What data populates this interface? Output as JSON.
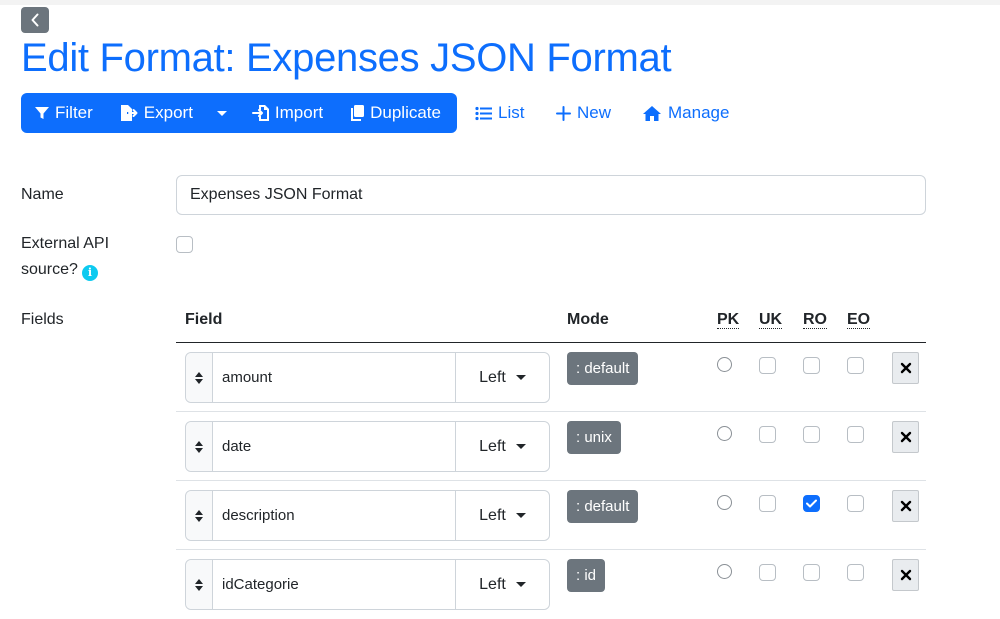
{
  "page": {
    "title": "Edit Format: Expenses JSON Format"
  },
  "toolbar": {
    "filter": "Filter",
    "export": "Export",
    "import": "Import",
    "duplicate": "Duplicate",
    "list": "List",
    "new": "New",
    "manage": "Manage"
  },
  "form": {
    "name_label": "Name",
    "name_value": "Expenses JSON Format",
    "api_label": "External API source?",
    "api_checked": false,
    "fields_label": "Fields"
  },
  "table": {
    "headers": {
      "field": "Field",
      "mode": "Mode",
      "pk": "PK",
      "uk": "UK",
      "ro": "RO",
      "eo": "EO"
    },
    "rows": [
      {
        "field": "amount",
        "align": "Left",
        "mode": ": default",
        "pk": false,
        "uk": false,
        "ro": false,
        "eo": false
      },
      {
        "field": "date",
        "align": "Left",
        "mode": ": unix",
        "pk": false,
        "uk": false,
        "ro": false,
        "eo": false
      },
      {
        "field": "description",
        "align": "Left",
        "mode": ": default",
        "pk": false,
        "uk": false,
        "ro": true,
        "eo": false
      },
      {
        "field": "idCategorie",
        "align": "Left",
        "mode": ": id",
        "pk": false,
        "uk": false,
        "ro": false,
        "eo": false
      }
    ]
  },
  "colors": {
    "primary": "#0d6efd",
    "secondary": "#6c757d",
    "info": "#0dcaf0"
  }
}
